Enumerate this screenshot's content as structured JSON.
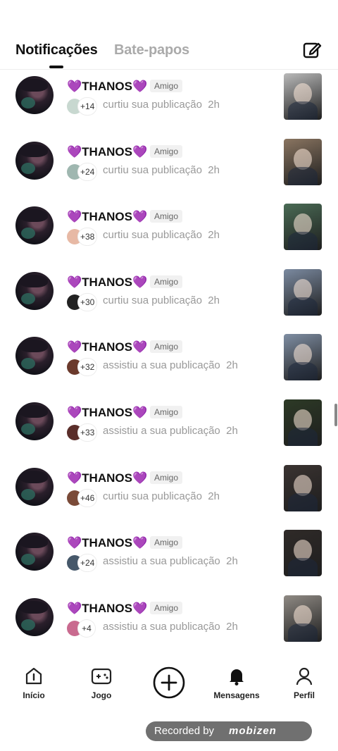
{
  "header": {
    "tab_active": "Notificações",
    "tab_inactive": "Bate-papos",
    "compose_icon": "edit-icon"
  },
  "notifications": [
    {
      "name": "💜THANOS💜",
      "badge": "Amigo",
      "count": "+14",
      "action": "curtiu sua publicação",
      "time": "2h",
      "thumb_color": "#b9b9b9",
      "mini_color": "#c8d8d0"
    },
    {
      "name": "💜THANOS💜",
      "badge": "Amigo",
      "count": "+24",
      "action": "curtiu sua publicação",
      "time": "2h",
      "thumb_color": "#8a7561",
      "mini_color": "#9fb7b0"
    },
    {
      "name": "💜THANOS💜",
      "badge": "Amigo",
      "count": "+38",
      "action": "curtiu sua publicação",
      "time": "2h",
      "thumb_color": "#4a6b55",
      "mini_color": "#e7b9a5"
    },
    {
      "name": "💜THANOS💜",
      "badge": "Amigo",
      "count": "+30",
      "action": "curtiu sua publicação",
      "time": "2h",
      "thumb_color": "#7b8aa0",
      "mini_color": "#222222"
    },
    {
      "name": "💜THANOS💜",
      "badge": "Amigo",
      "count": "+32",
      "action": "assistiu a sua publicação",
      "time": "2h",
      "thumb_color": "#7f8ea3",
      "mini_color": "#6b3a2c"
    },
    {
      "name": "💜THANOS💜",
      "badge": "Amigo",
      "count": "+33",
      "action": "assistiu a sua publicação",
      "time": "2h",
      "thumb_color": "#2d3a26",
      "mini_color": "#5a2e2a"
    },
    {
      "name": "💜THANOS💜",
      "badge": "Amigo",
      "count": "+46",
      "action": "curtiu sua publicação",
      "time": "2h",
      "thumb_color": "#3a3331",
      "mini_color": "#7a4a38"
    },
    {
      "name": "💜THANOS💜",
      "badge": "Amigo",
      "count": "+24",
      "action": "assistiu a sua publicação",
      "time": "2h",
      "thumb_color": "#2f2a28",
      "mini_color": "#46586a"
    },
    {
      "name": "💜THANOS💜",
      "badge": "Amigo",
      "count": "+4",
      "action": "assistiu a sua publicação",
      "time": "2h",
      "thumb_color": "#8f8a84",
      "mini_color": "#c96a8f"
    }
  ],
  "nav": [
    {
      "label": "Início",
      "icon": "home-icon"
    },
    {
      "label": "Jogo",
      "icon": "gamepad-icon"
    },
    {
      "label": "",
      "icon": "create-plus-icon"
    },
    {
      "label": "Mensagens",
      "icon": "bell-icon"
    },
    {
      "label": "Perfil",
      "icon": "profile-icon"
    }
  ],
  "recorder": {
    "text": "Recorded by",
    "brand": "mobizen"
  }
}
